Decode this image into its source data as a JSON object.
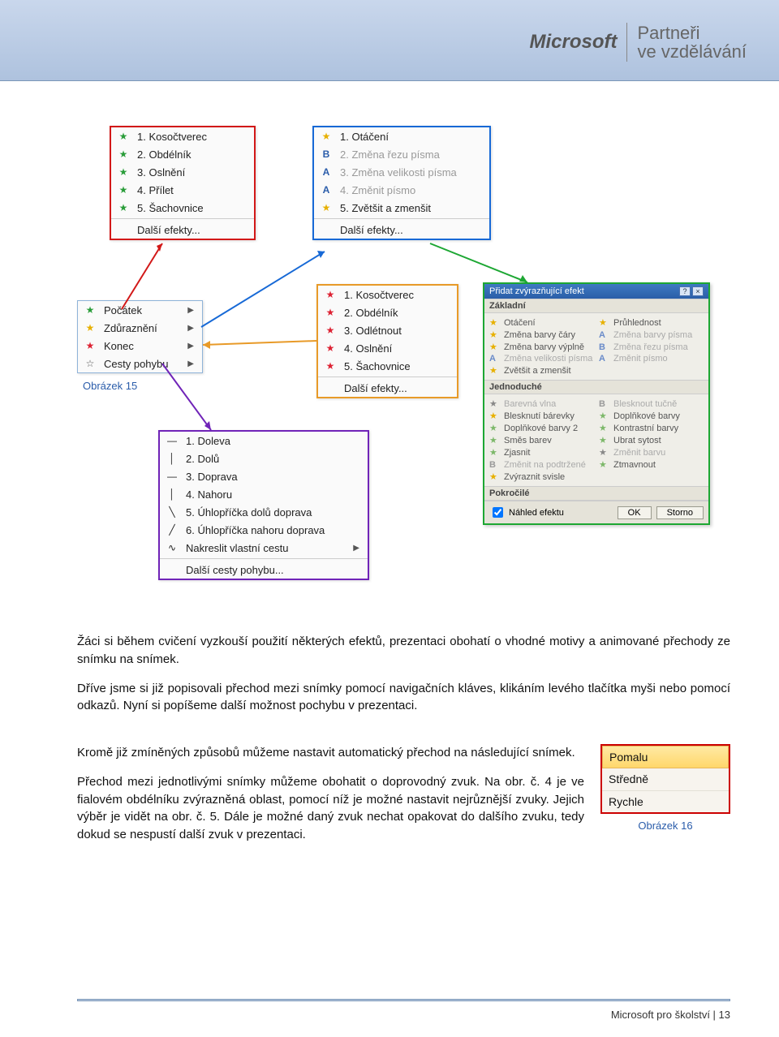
{
  "header": {
    "logo": "Microsoft",
    "partner_line1": "Partneři",
    "partner_line2": "ve vzdělávání"
  },
  "caption15": "Obrázek 15",
  "menu_red": {
    "items": [
      "1. Kosočtverec",
      "2. Obdélník",
      "3. Oslnění",
      "4. Přílet",
      "5. Šachovnice"
    ],
    "more": "Další efekty..."
  },
  "menu_blue": {
    "items": [
      "1. Otáčení",
      "2. Změna řezu písma",
      "3. Změna velikosti písma",
      "4. Změnit písmo",
      "5. Zvětšit a zmenšit"
    ],
    "more": "Další efekty..."
  },
  "menu_cyan": {
    "items": [
      "Počátek",
      "Zdůraznění",
      "Konec",
      "Cesty pohybu"
    ]
  },
  "menu_orange": {
    "items": [
      "1. Kosočtverec",
      "2. Obdélník",
      "3. Odlétnout",
      "4. Oslnění",
      "5. Šachovnice"
    ],
    "more": "Další efekty..."
  },
  "menu_purple": {
    "items": [
      "1. Doleva",
      "2. Dolů",
      "3. Doprava",
      "4. Nahoru",
      "5. Úhlopříčka dolů doprava",
      "6. Úhlopříčka nahoru doprava",
      "Nakreslit vlastní cestu"
    ],
    "more": "Další cesty pohybu..."
  },
  "dialog": {
    "title": "Přidat zvýrazňující efekt",
    "sec1": "Základní",
    "rows1": [
      [
        "Otáčení",
        "Průhlednost"
      ],
      [
        "Změna barvy čáry",
        "Změna barvy písma"
      ],
      [
        "Změna barvy výplně",
        "Změna řezu písma"
      ],
      [
        "Změna velikosti písma",
        "Změnit písmo"
      ],
      [
        "Zvětšit a zmenšit",
        ""
      ]
    ],
    "sec2": "Jednoduché",
    "rows2": [
      [
        "Barevná vlna",
        "Blesknout tučně"
      ],
      [
        "Blesknutí bárevky",
        "Doplňkové barvy"
      ],
      [
        "Doplňkové barvy 2",
        "Kontrastní barvy"
      ],
      [
        "Směs barev",
        "Ubrat sytost"
      ],
      [
        "Zjasnit",
        "Změnit barvu"
      ],
      [
        "Změnit na podtržené",
        "Ztmavnout"
      ],
      [
        "Zvýraznit svisle",
        ""
      ]
    ],
    "sec3": "Pokročilé",
    "preview": "Náhled efektu",
    "ok": "OK",
    "cancel": "Storno"
  },
  "para1": "Žáci si během cvičení vyzkouší použití některých efektů, prezentaci obohatí o vhodné motivy a animované přechody ze snímku na snímek.",
  "para2": "Dříve jsme si již popisovali přechod mezi snímky pomocí navigačních kláves, klikáním levého tlačítka myši nebo pomocí odkazů. Nyní si popíšeme další možnost pochybu v prezentaci.",
  "para3": "Kromě již zmíněných způsobů můžeme nastavit automatický přechod na následující snímek.",
  "para4": "Přechod mezi jednotlivými snímky můžeme obohatit o doprovodný zvuk. Na obr. č. 4 je ve fialovém obdélníku zvýrazněná oblast, pomocí níž je možné nastavit nejrůznější zvuky. Jejich výběr je vidět na obr. č. 5. Dále je možné daný zvuk nechat opakovat do dalšího zvuku, tedy dokud se nespustí další zvuk v prezentaci.",
  "speed": {
    "slow": "Pomalu",
    "medium": "Středně",
    "fast": "Rychle"
  },
  "caption16": "Obrázek 16",
  "footer": "Microsoft pro školství | 13"
}
